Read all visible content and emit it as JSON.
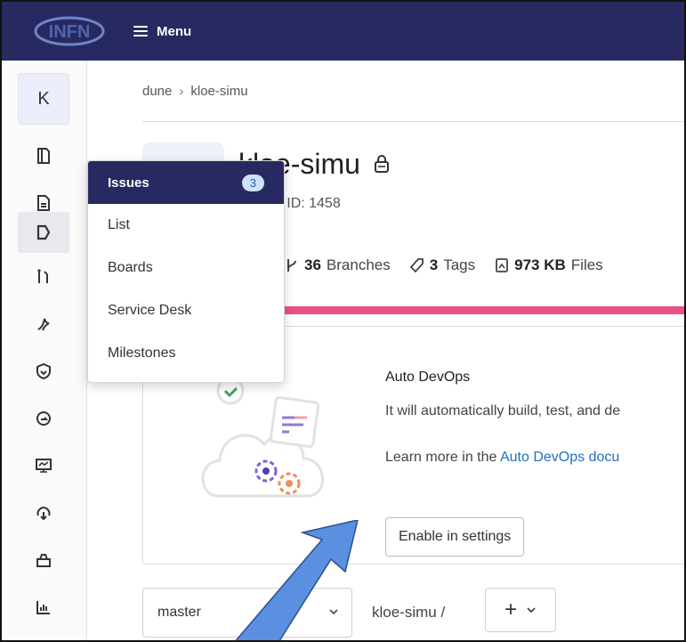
{
  "navbar": {
    "logo_text": "INFN",
    "menu_label": "Menu"
  },
  "sidebar": {
    "avatar_letter": "K",
    "items": [
      {
        "icon": "project-overview-icon"
      },
      {
        "icon": "repository-icon"
      },
      {
        "icon": "issues-icon",
        "active": true
      },
      {
        "icon": "merge-requests-icon"
      },
      {
        "icon": "ci-cd-icon"
      },
      {
        "icon": "security-icon"
      },
      {
        "icon": "deployments-icon"
      },
      {
        "icon": "monitor-icon"
      },
      {
        "icon": "infrastructure-icon"
      },
      {
        "icon": "packages-icon"
      },
      {
        "icon": "analytics-icon"
      },
      {
        "icon": "wiki-icon"
      }
    ]
  },
  "breadcrumb": {
    "group": "dune",
    "separator": "›",
    "project": "kloe-simu"
  },
  "project": {
    "name": "kloe-simu",
    "id_text": "Project ID: 1458"
  },
  "stats": {
    "branches_count": "36",
    "branches_label": "Branches",
    "tags_count": "3",
    "tags_label": "Tags",
    "files_size": "973 KB",
    "files_label": "Files"
  },
  "devops": {
    "title": "Auto DevOps",
    "description": "It will automatically build, test, and de",
    "learn_prefix": "Learn more in the ",
    "learn_link": "Auto DevOps docu",
    "enable_label": "Enable in settings"
  },
  "repo_bar": {
    "branch": "master",
    "path": "kloe-simu",
    "path_sep": "/",
    "add_label": "+"
  },
  "flyout": {
    "title": "Issues",
    "count": "3",
    "items": [
      "List",
      "Boards",
      "Service Desk",
      "Milestones"
    ]
  },
  "colors": {
    "navbar": "#292961",
    "accent_bar": "#ec5088",
    "link": "#1f6fc2",
    "arrow": "#5b8fe0"
  }
}
